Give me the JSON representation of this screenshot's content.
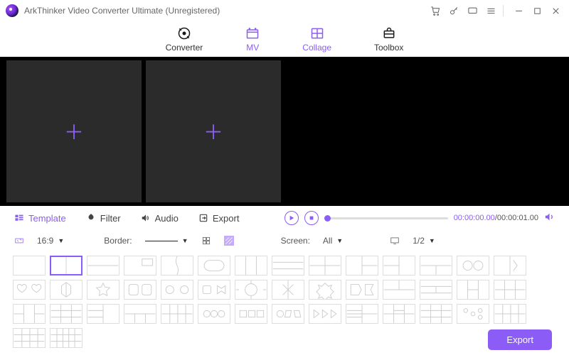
{
  "titlebar": {
    "title": "ArkThinker Video Converter Ultimate (Unregistered)"
  },
  "nav": {
    "converter": "Converter",
    "mv": "MV",
    "collage": "Collage",
    "toolbox": "Toolbox"
  },
  "tabs": {
    "template": "Template",
    "filter": "Filter",
    "audio": "Audio",
    "export": "Export"
  },
  "player": {
    "current": "00:00:00.00",
    "total": "00:00:01.00"
  },
  "options": {
    "ratio": "16:9",
    "border_label": "Border:",
    "screen_label": "Screen:",
    "screen_value": "All",
    "page": "1/2"
  },
  "footer": {
    "export": "Export"
  }
}
